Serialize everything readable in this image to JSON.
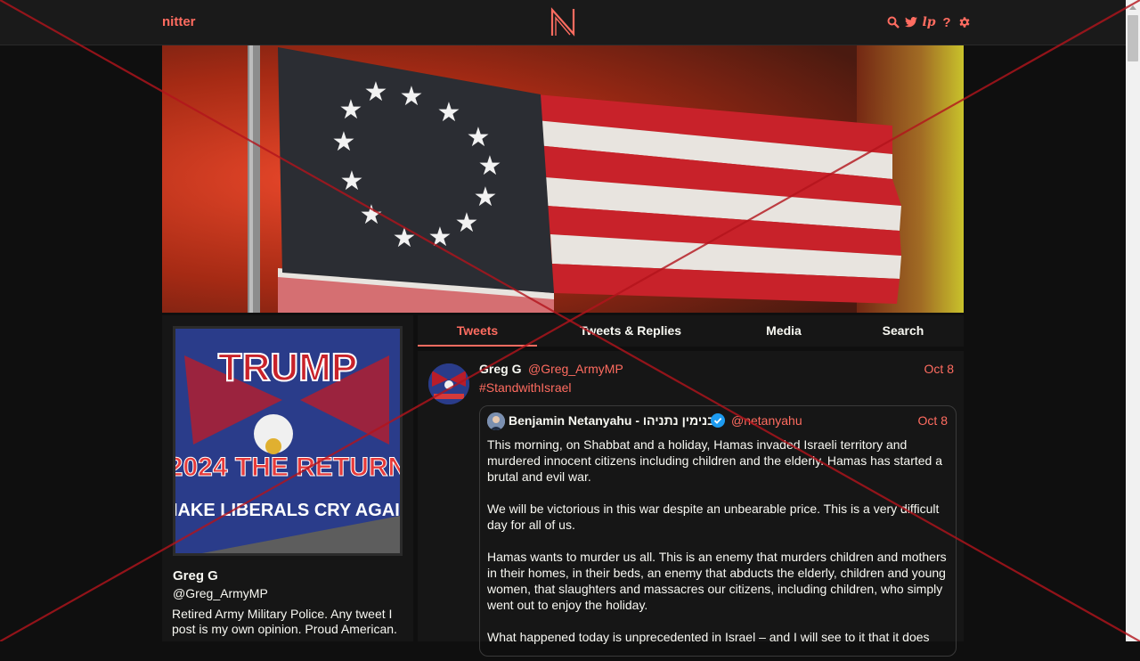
{
  "nav": {
    "brand": "nitter",
    "logo_letter": "N",
    "icons": [
      "search-icon",
      "twitter-icon",
      "lp-icon",
      "help-icon",
      "gear-icon"
    ],
    "lp_text": "lp",
    "help_text": "?"
  },
  "profile": {
    "fullname": "Greg G",
    "username": "@Greg_ArmyMP",
    "bio": "Retired Army Military Police. Any tweet I post is my own opinion. Proud American.",
    "avatar_flag": {
      "top_text": "TRUMP",
      "middle_text": "2024 THE RETURN",
      "bottom_text": "MAKE LIBERALS CRY AGAIN"
    }
  },
  "tabs": [
    {
      "label": "Tweets",
      "active": true
    },
    {
      "label": "Tweets & Replies",
      "active": false
    },
    {
      "label": "Media",
      "active": false
    },
    {
      "label": "Search",
      "active": false
    }
  ],
  "tweet": {
    "fullname": "Greg G",
    "username": "@Greg_ArmyMP",
    "date": "Oct 8",
    "text": "#StandwithIsrael",
    "quote": {
      "fullname": "Benjamin Netanyahu - בנימין נתניהו",
      "username": "@netanyahu",
      "date": "Oct 8",
      "paragraphs": [
        "This morning, on Shabbat and a holiday, Hamas invaded Israeli territory and murdered innocent citizens including children and the elderly. Hamas has started a brutal and evil war.",
        "We will be victorious in this war despite an unbearable price. This is a very difficult day for all of us.",
        "Hamas wants to murder us all. This is an enemy that murders children and mothers in their homes, in their beds, an enemy that abducts the elderly, children and young women, that slaughters and massacres our citizens, including children, who simply went out to enjoy the holiday.",
        "What happened today is unprecedented in Israel – and I will see to it that it does"
      ]
    }
  },
  "colors": {
    "accent": "#ff6c60",
    "background": "#0f0f0f",
    "panel": "#161616",
    "overlay_cross": "#b3141c"
  }
}
